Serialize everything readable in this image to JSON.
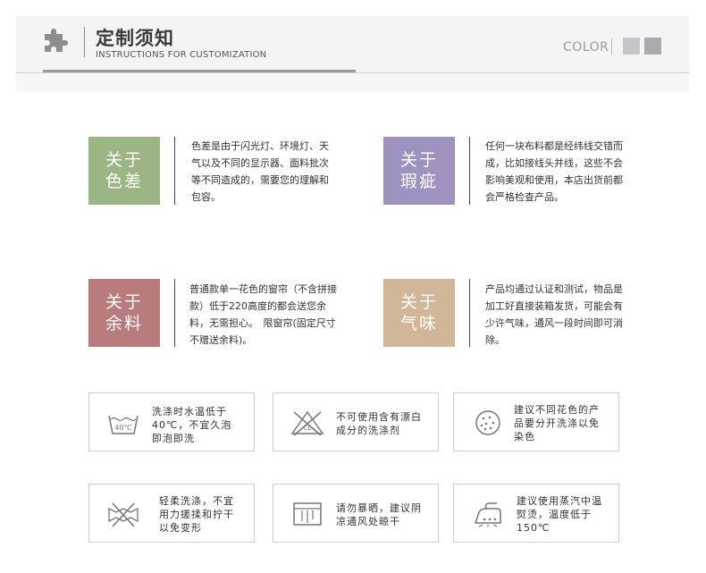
{
  "header": {
    "title": "定制须知",
    "subtitle": "INSTRUCTIONS FOR CUSTOMIZATION",
    "color_label": "COLOR",
    "swatches": [
      "#c3c7c9",
      "#a9acae"
    ]
  },
  "about": [
    {
      "label": "关于\n色差",
      "color": "#9cb585",
      "text": "色差是由于闪光灯、环境灯、天气以及不同的显示器、面料批次等不同造成的，需要您的理解和包容。"
    },
    {
      "label": "关于\n瑕疵",
      "color": "#9f91c0",
      "text": "任何一块布料都是经纬线交错而成，比如接线头并线，这些不会影响美观和使用，本店出货前都会严格检查产品。"
    },
    {
      "label": "关于\n余料",
      "color": "#b97b7b",
      "text": "普通款单一花色的窗帘（不含拼接款）低于220高度的都会送您余料，无需担心。　限窗帘(固定尺寸不赠送余料)。"
    },
    {
      "label": "关于\n气味",
      "color": "#d2b699",
      "text": "产品均通过认证和测试，物品是加工好直接装箱发货，可能会有少许气味，通风一段时间即可消除。"
    }
  ],
  "care": [
    {
      "icon": "wash-40-icon",
      "text": "洗涤时水温低于40℃，不宜久泡即泡即洗"
    },
    {
      "icon": "no-bleach-icon",
      "text": "不可使用含有漂白成分的洗涤剂"
    },
    {
      "icon": "separate-wash-icon",
      "text": "建议不同花色的产品要分开洗涤以免染色"
    },
    {
      "icon": "no-wring-icon",
      "text": "轻柔洗涤，不宜用力搓揉和拧干以免变形"
    },
    {
      "icon": "shade-dry-icon",
      "text": "请勿暴晒，建议阴凉通风处晾干"
    },
    {
      "icon": "steam-iron-icon",
      "text": "建议使用蒸汽中温熨烫，温度低于150℃"
    }
  ],
  "icon_labels": {
    "wash_temp": "40℃",
    "bleach_mark": "CL"
  }
}
